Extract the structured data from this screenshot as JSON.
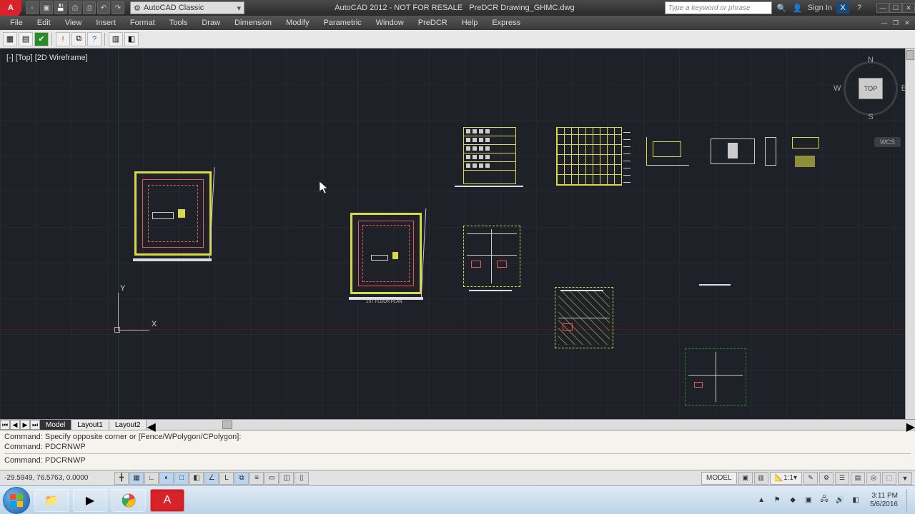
{
  "title": {
    "app": "AutoCAD 2012 - NOT FOR RESALE",
    "doc": "PreDCR Drawing_GHMC.dwg"
  },
  "workspace": "AutoCAD Classic",
  "search_placeholder": "Type a keyword or phrase",
  "sign_in": "Sign In",
  "menus": [
    "File",
    "Edit",
    "View",
    "Insert",
    "Format",
    "Tools",
    "Draw",
    "Dimension",
    "Modify",
    "Parametric",
    "Window",
    "PreDCR",
    "Help",
    "Express"
  ],
  "viewport_label": "[-] [Top] [2D Wireframe]",
  "viewcube": {
    "top": "TOP",
    "n": "N",
    "s": "S",
    "e": "E",
    "w": "W",
    "wcs": "WCS"
  },
  "ucs": {
    "x": "X",
    "y": "Y"
  },
  "layout_tabs": {
    "active": "Model",
    "others": [
      "Layout1",
      "Layout2"
    ]
  },
  "command_history": [
    "Command: Specify opposite corner or [Fence/WPolygon/CPolygon]:",
    "Command: PDCRNWP"
  ],
  "command_current": "Command: PDCRNWP",
  "coords": "-29.5949, 76.5763, 0.0000",
  "status_right": {
    "model": "MODEL",
    "scale": "1:1"
  },
  "taskbar": {
    "time": "3:11 PM",
    "date": "5/6/2016"
  },
  "plan_label": "1ST FLOOR PLAN"
}
